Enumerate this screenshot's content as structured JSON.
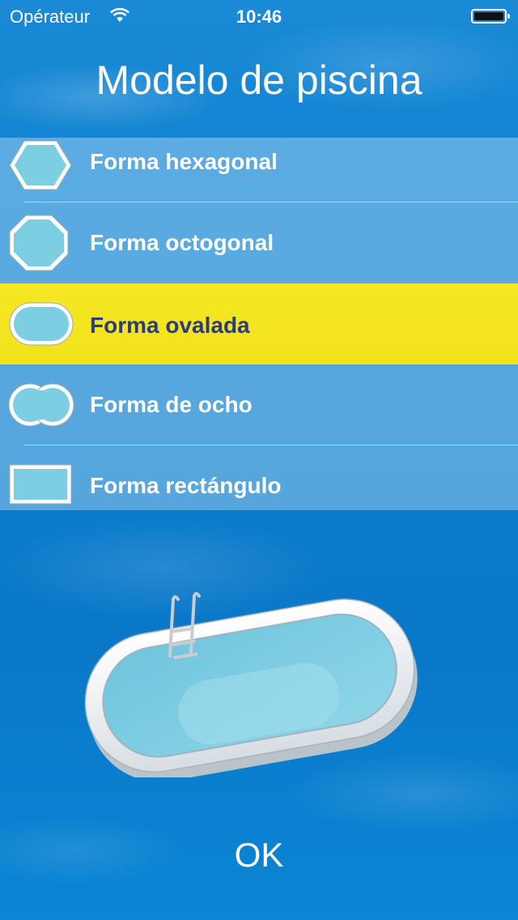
{
  "status_bar": {
    "carrier": "Opérateur",
    "time": "10:46"
  },
  "title": "Modelo de piscina",
  "shapes": [
    {
      "label": "Forma hexagonal",
      "icon": "hexagon-pool-icon",
      "selected": false
    },
    {
      "label": "Forma octogonal",
      "icon": "octagon-pool-icon",
      "selected": false
    },
    {
      "label": "Forma ovalada",
      "icon": "oval-pool-icon",
      "selected": true
    },
    {
      "label": "Forma de ocho",
      "icon": "figure-eight-pool-icon",
      "selected": false
    },
    {
      "label": "Forma rectángulo",
      "icon": "rectangle-pool-icon",
      "selected": false
    }
  ],
  "ok_label": "OK",
  "colors": {
    "accent_selected": "#f4e824",
    "selected_text": "#2a3c7a",
    "water": "#0a7fd0"
  }
}
